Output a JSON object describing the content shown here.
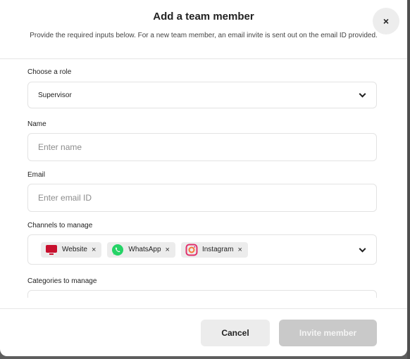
{
  "modal": {
    "title": "Add a team member",
    "subtitle": "Provide the required inputs below. For a new team member, an email invite is sent out on the email ID provided.",
    "close_label": "×"
  },
  "form": {
    "role": {
      "label": "Choose a role",
      "value": "Supervisor"
    },
    "name": {
      "label": "Name",
      "placeholder": "Enter name",
      "value": ""
    },
    "email": {
      "label": "Email",
      "placeholder": "Enter email ID",
      "value": ""
    },
    "channels": {
      "label": "Channels to manage",
      "selected": [
        {
          "label": "Website",
          "icon": "monitor-icon",
          "color": "#c8102e"
        },
        {
          "label": "WhatsApp",
          "icon": "whatsapp-icon",
          "color": "#25d366"
        },
        {
          "label": "Instagram",
          "icon": "instagram-icon",
          "color": "#e1306c"
        }
      ],
      "remove_label": "×"
    },
    "categories": {
      "label": "Categories to manage"
    }
  },
  "footer": {
    "cancel_label": "Cancel",
    "invite_label": "Invite member"
  }
}
